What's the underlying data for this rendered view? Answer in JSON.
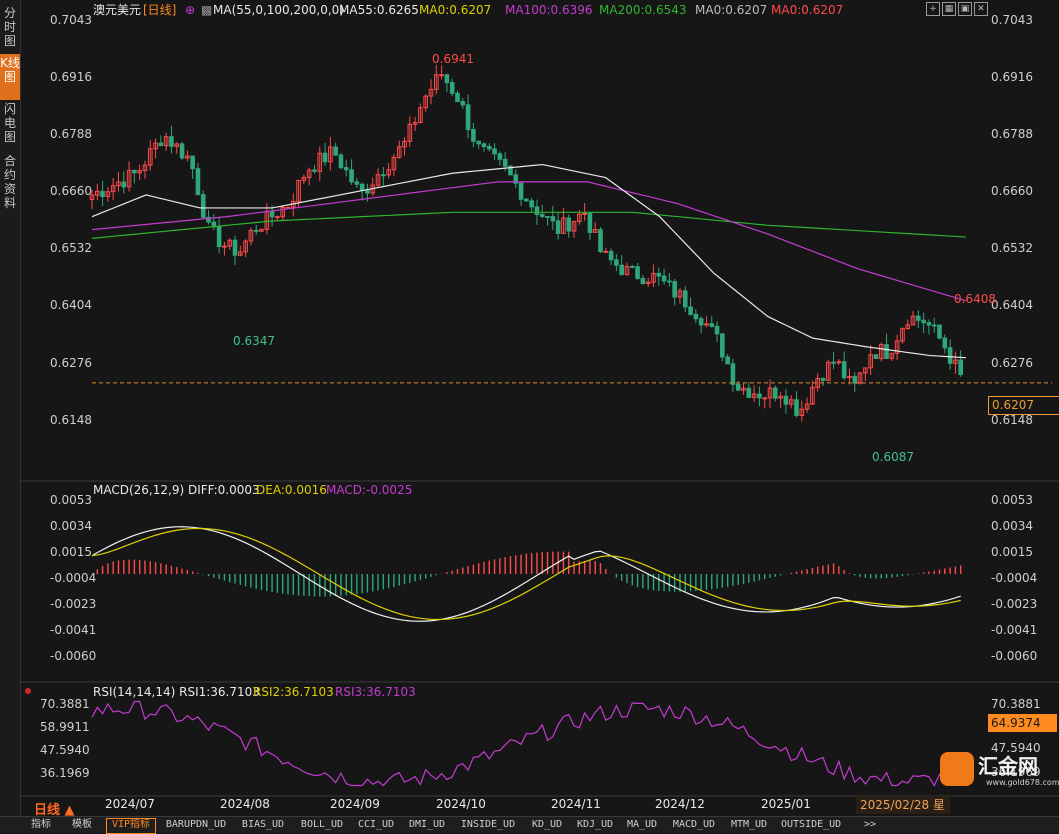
{
  "sidebar": [
    {
      "label": "分时图",
      "active": false
    },
    {
      "label": "K线图",
      "active": true
    },
    {
      "label": "闪电图",
      "active": false
    },
    {
      "label": "合约资料",
      "active": false
    }
  ],
  "header": {
    "symbol": "澳元美元",
    "period": "[日线]",
    "ma_params": "MA(55,0,100,200,0,0)",
    "ma55": "MA55:0.6265",
    "ma0a": "MA0:0.6207",
    "ma100": "MA100:0.6396",
    "ma200": "MA200:0.6543",
    "ma0b": "MA0:0.6207",
    "ma0c": "MA0:0.6207"
  },
  "price_axis": [
    "0.7043",
    "0.6916",
    "0.6788",
    "0.6660",
    "0.6532",
    "0.6404",
    "0.6276",
    "0.6148"
  ],
  "price_annotations": {
    "high_main": "0.6941",
    "low_main": "0.6347",
    "high_right": "0.6408",
    "low_right": "0.6087",
    "current": "0.6207"
  },
  "macd": {
    "title": "MACD(26,12,9)",
    "diff": "DIFF:0.0003",
    "dea": "DEA:0.0016",
    "macd": "MACD:-0.0025",
    "axis": [
      "0.0053",
      "0.0034",
      "0.0015",
      "-0.0004",
      "-0.0023",
      "-0.0041",
      "-0.0060"
    ]
  },
  "rsi": {
    "title": "RSI(14,14,14)",
    "rsi1": "RSI1:36.7103",
    "rsi2": "RSI2:36.7103",
    "rsi3": "RSI3:36.7103",
    "axis_left": [
      "70.3881",
      "58.9911",
      "47.5940",
      "36.1969"
    ],
    "axis_right": [
      "70.3881",
      "47.5940",
      "36.1969"
    ],
    "current_tag": "64.9374"
  },
  "x_labels": [
    "2024/07",
    "2024/08",
    "2024/09",
    "2024/10",
    "2024/11",
    "2024/12",
    "2025/01"
  ],
  "period_label": "日线 ▲",
  "date_box": "2025/02/28 星",
  "logo": {
    "text": "汇金网",
    "url": "www.gold678.com"
  },
  "bottom_tabs": [
    "指标",
    "模板",
    "VIP指标",
    "BARUPDN_UD",
    "BIAS_UD",
    "BOLL_UD",
    "CCI_UD",
    "DMI_UD",
    "INSIDE_UD",
    "KD_UD",
    "KDJ_UD",
    "MA_UD",
    "MACD_UD",
    "MTM_UD",
    "OUTSIDE_UD",
    ">>"
  ],
  "colors": {
    "up": "#ff4a4a",
    "down": "#2fa77a",
    "ma55": "#e9e9e9",
    "ma100": "#c43bd1",
    "ma200": "#2fb52f",
    "dea": "#e0d000",
    "rsi": "#c43bd1",
    "accent": "#ff8a1f"
  },
  "chart_data": {
    "type": "candlestick",
    "title": "澳元美元 [日线]",
    "ylim": [
      0.6087,
      0.7043
    ],
    "key_points": [
      {
        "label": "low",
        "value": 0.6347
      },
      {
        "label": "high",
        "value": 0.6941
      },
      {
        "label": "local high",
        "value": 0.6408
      },
      {
        "label": "low",
        "value": 0.6087
      },
      {
        "label": "last",
        "value": 0.6207
      }
    ],
    "indicators": {
      "MA55": 0.6265,
      "MA100": 0.6396,
      "MA200": 0.6543,
      "MACD": {
        "DIFF": 0.0003,
        "DEA": 0.0016,
        "MACD": -0.0025
      },
      "RSI": {
        "RSI1": 36.7103,
        "RSI2": 36.7103,
        "RSI3": 36.7103
      }
    }
  }
}
